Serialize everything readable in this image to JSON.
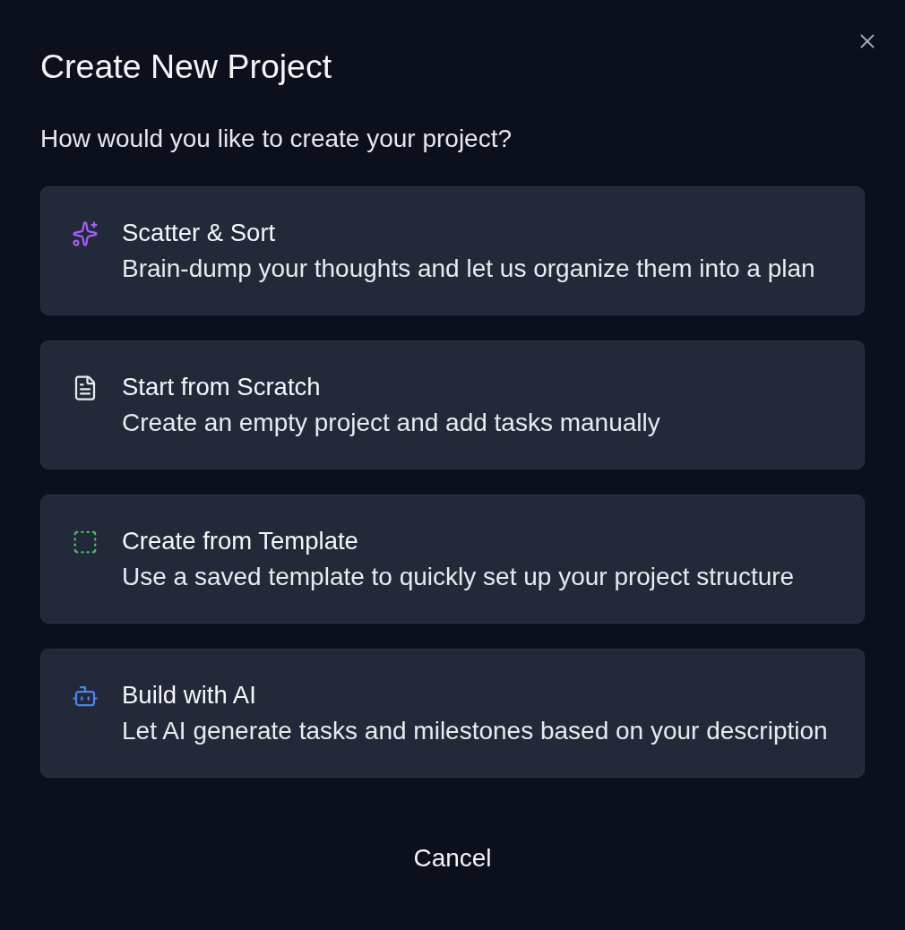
{
  "dialog": {
    "title": "Create New Project",
    "subtitle": "How would you like to create your project?",
    "options": [
      {
        "kind": "sparkles",
        "color": "#a55ef5",
        "title": "Scatter & Sort",
        "description": "Brain-dump your thoughts and let us organize them into a plan"
      },
      {
        "kind": "document",
        "color": "#e8eaee",
        "title": "Start from Scratch",
        "description": "Create an empty project and add tasks manually"
      },
      {
        "kind": "dashed-square",
        "color": "#4cc25e",
        "title": "Create from Template",
        "description": "Use a saved template to quickly set up your project structure"
      },
      {
        "kind": "robot",
        "color": "#4a85f0",
        "title": "Build with AI",
        "description": "Let AI generate tasks and milestones based on your description"
      }
    ],
    "cancel_button": "Cancel"
  }
}
